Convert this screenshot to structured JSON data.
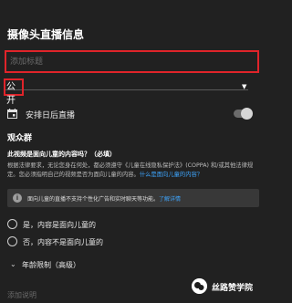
{
  "panel": {
    "title": "摄像头直播信息"
  },
  "title_field": {
    "placeholder": "添加标题"
  },
  "privacy": {
    "selected": "公开",
    "caret": "▼"
  },
  "schedule": {
    "icon": "calendar-icon",
    "label": "安排日后直播"
  },
  "audience": {
    "heading": "观众群",
    "question": "此视频是面向儿童的内容吗？（必填）",
    "legal_text": "根据法律要求，无论您身在何处，都必须遵守《儿童在线隐私保护法》(COPPA) 和/或其他法律规定。您必须指明自己的视频是否为面向儿童的内容。",
    "legal_link": "什么是面向儿童的内容？",
    "info_text": "面向儿童的直播不支持个性化广告和实时聊天等功能。",
    "info_link": "了解详情",
    "options": [
      {
        "label": "是，内容是面向儿童的"
      },
      {
        "label": "否，内容不是面向儿童的"
      }
    ]
  },
  "age_restriction": {
    "caret": "⌄",
    "label": "年龄限制（高级）"
  },
  "description": {
    "placeholder": "添加说明"
  },
  "watermark": {
    "text": "丝路赞学院"
  },
  "colors": {
    "background": "#212121",
    "highlight_red": "#e0242a",
    "link_blue": "#3ea6ff"
  }
}
